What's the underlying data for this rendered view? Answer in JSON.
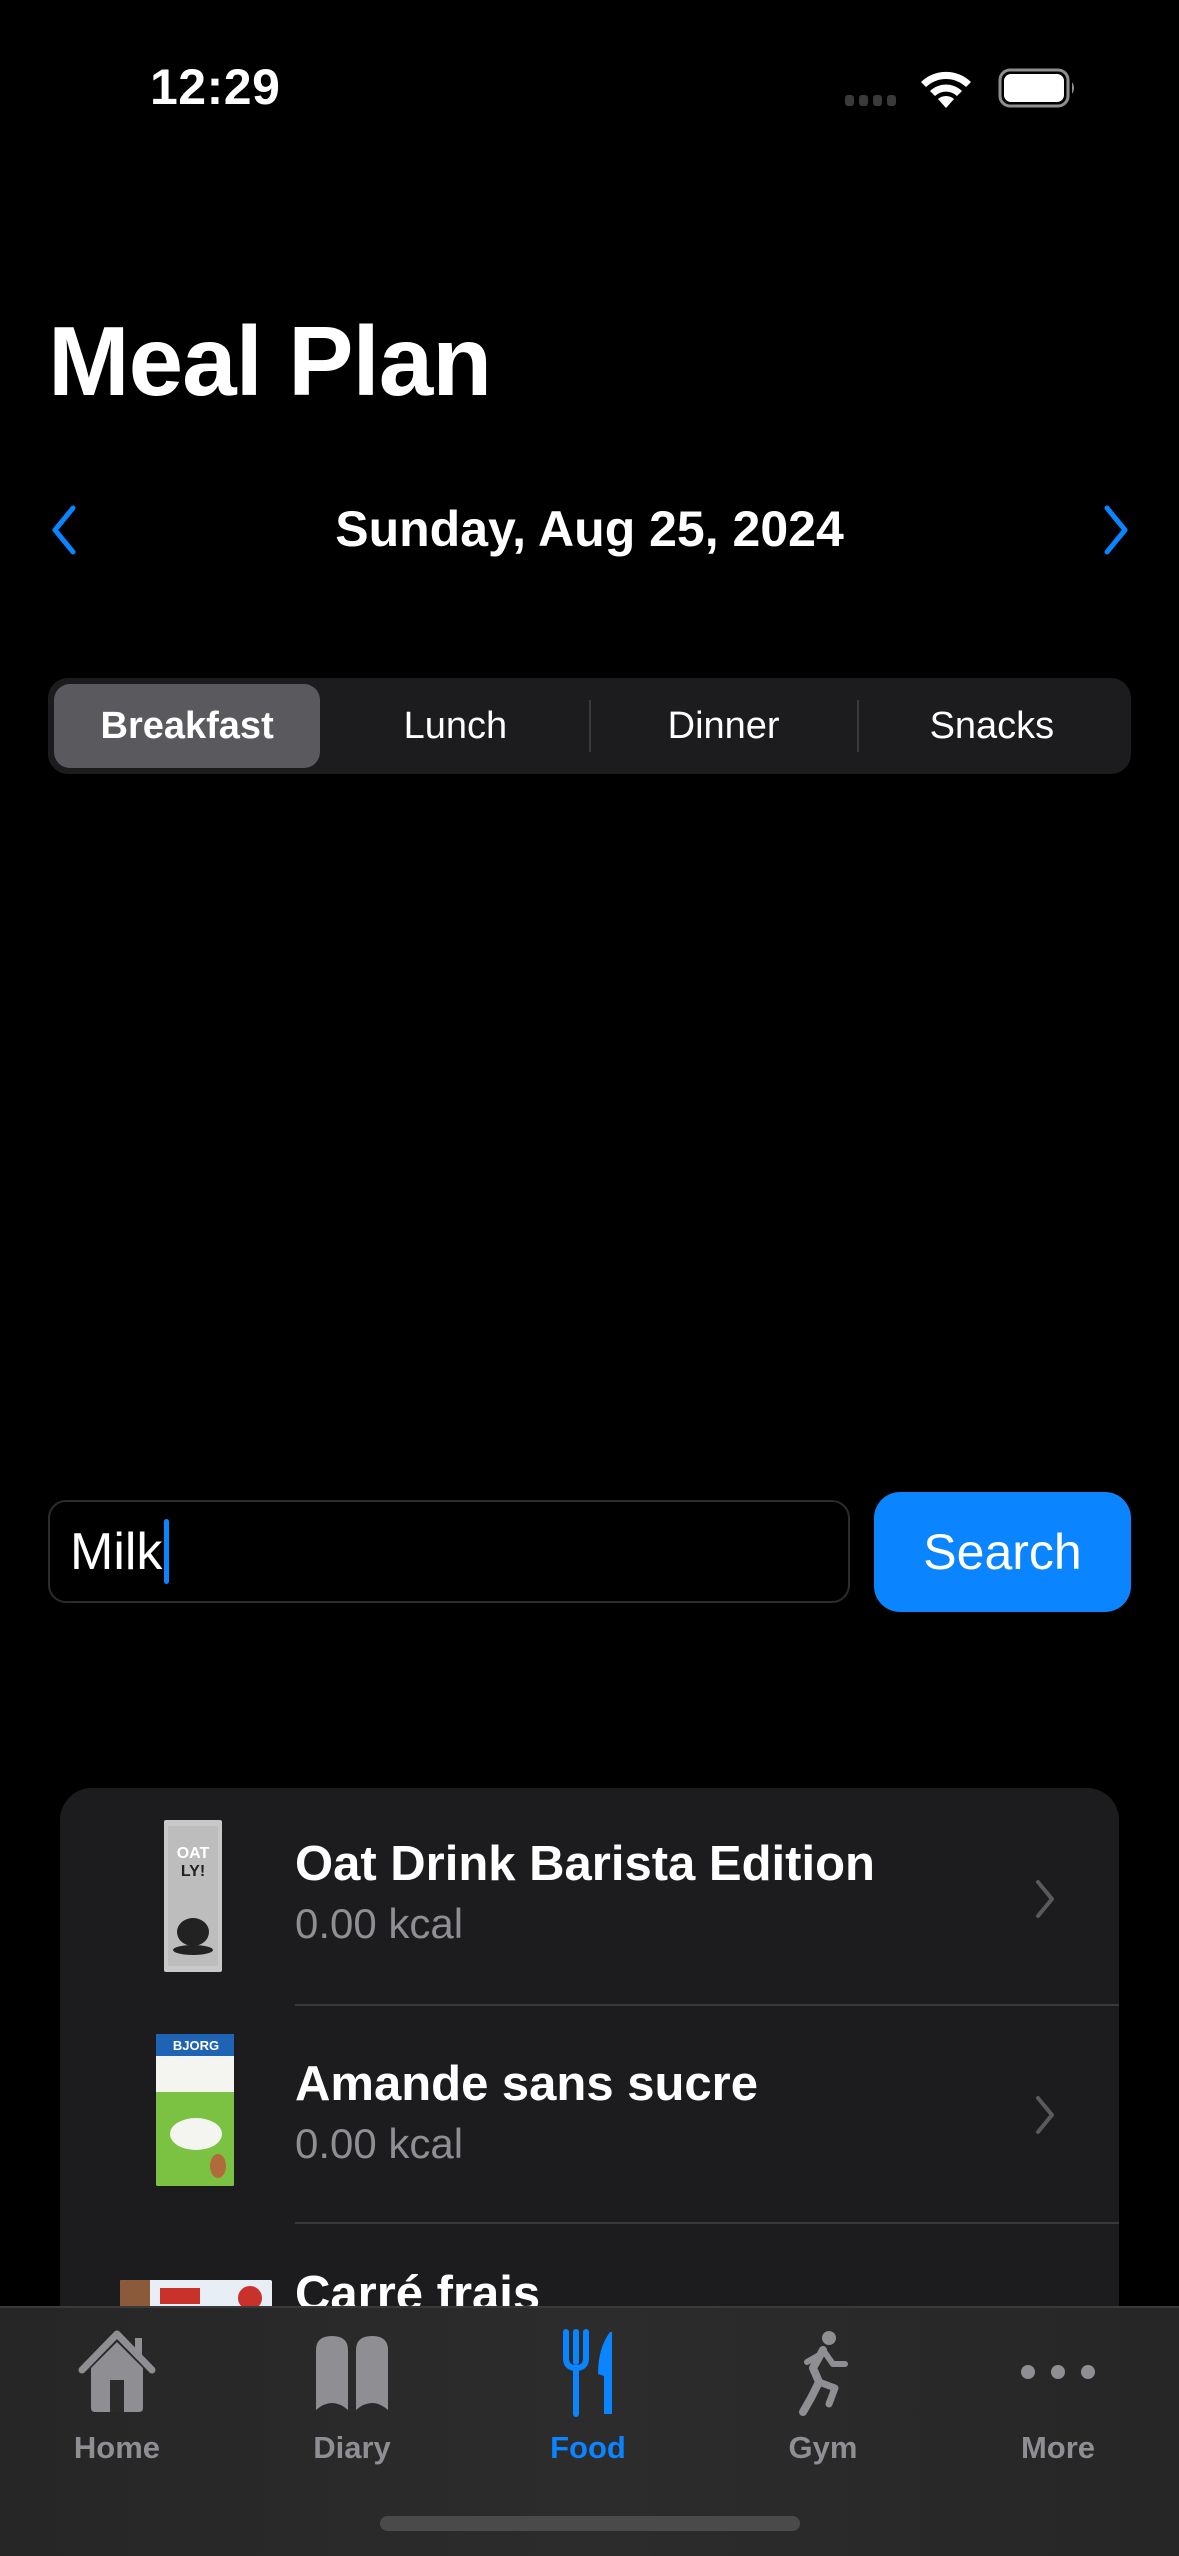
{
  "status_bar": {
    "time": "12:29",
    "signal": "signal-dots-icon",
    "wifi": "wifi-icon",
    "battery": "battery-full-icon"
  },
  "header": {
    "title": "Meal Plan"
  },
  "date_nav": {
    "date": "Sunday, Aug 25, 2024",
    "prev_icon": "chevron-left-icon",
    "next_icon": "chevron-right-icon"
  },
  "meal_tabs": {
    "selected": "Breakfast",
    "items": [
      {
        "label": "Breakfast"
      },
      {
        "label": "Lunch"
      },
      {
        "label": "Dinner"
      },
      {
        "label": "Snacks"
      }
    ]
  },
  "search": {
    "value": "Milk",
    "button_label": "Search"
  },
  "results": [
    {
      "name": "Oat Drink Barista Edition",
      "kcal": "0.00 kcal",
      "thumb": "oatly-carton-image"
    },
    {
      "name": "Amande sans sucre",
      "kcal": "0.00 kcal",
      "thumb": "bjorg-carton-image"
    },
    {
      "name": "Carré frais",
      "kcal": "",
      "thumb": "carre-frais-package-image"
    }
  ],
  "tab_bar": {
    "active": "Food",
    "accent_color": "#0a84ff",
    "inactive_color": "#8e8e93",
    "items": [
      {
        "label": "Home",
        "icon": "house-icon"
      },
      {
        "label": "Diary",
        "icon": "book-icon"
      },
      {
        "label": "Food",
        "icon": "fork-knife-icon"
      },
      {
        "label": "Gym",
        "icon": "running-figure-icon"
      },
      {
        "label": "More",
        "icon": "ellipsis-icon"
      }
    ]
  }
}
